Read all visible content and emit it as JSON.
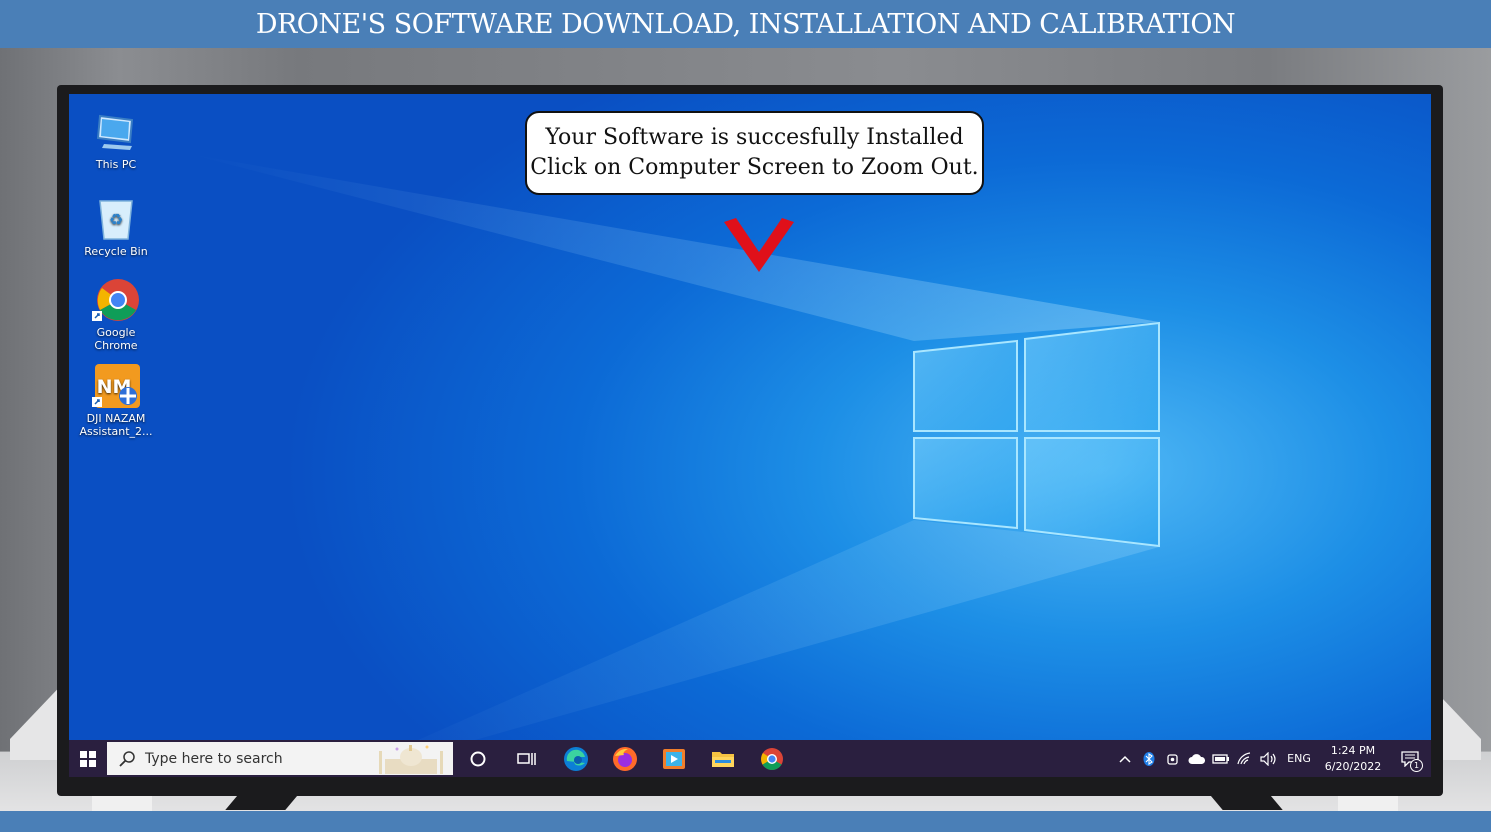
{
  "banner": {
    "title": "DRONE'S SOFTWARE DOWNLOAD, INSTALLATION AND CALIBRATION"
  },
  "desktop": {
    "icons": [
      {
        "label": "This PC",
        "icon": "computer-icon"
      },
      {
        "label": "Recycle Bin",
        "icon": "recycle-bin-icon"
      },
      {
        "label": "Google Chrome",
        "icon": "chrome-icon"
      },
      {
        "label": "DJI NAZAM Assistant_2...",
        "icon": "dji-nazam-icon"
      }
    ]
  },
  "callout": {
    "line1": "Your Software is succesfully Installed",
    "line2": "Click on Computer Screen to Zoom Out."
  },
  "taskbar": {
    "search_placeholder": "Type here to search",
    "apps": [
      "cortana-icon",
      "task-view-icon",
      "edge-icon",
      "firefox-icon",
      "media-player-icon",
      "file-explorer-icon",
      "chrome-icon"
    ],
    "tray": {
      "language": "ENG",
      "time": "1:24 PM",
      "date": "6/20/2022",
      "notification_count": "1"
    }
  },
  "colors": {
    "banner": "#4a7fb7",
    "taskbar": "#2a1f3f",
    "arrow": "#e0101a"
  }
}
